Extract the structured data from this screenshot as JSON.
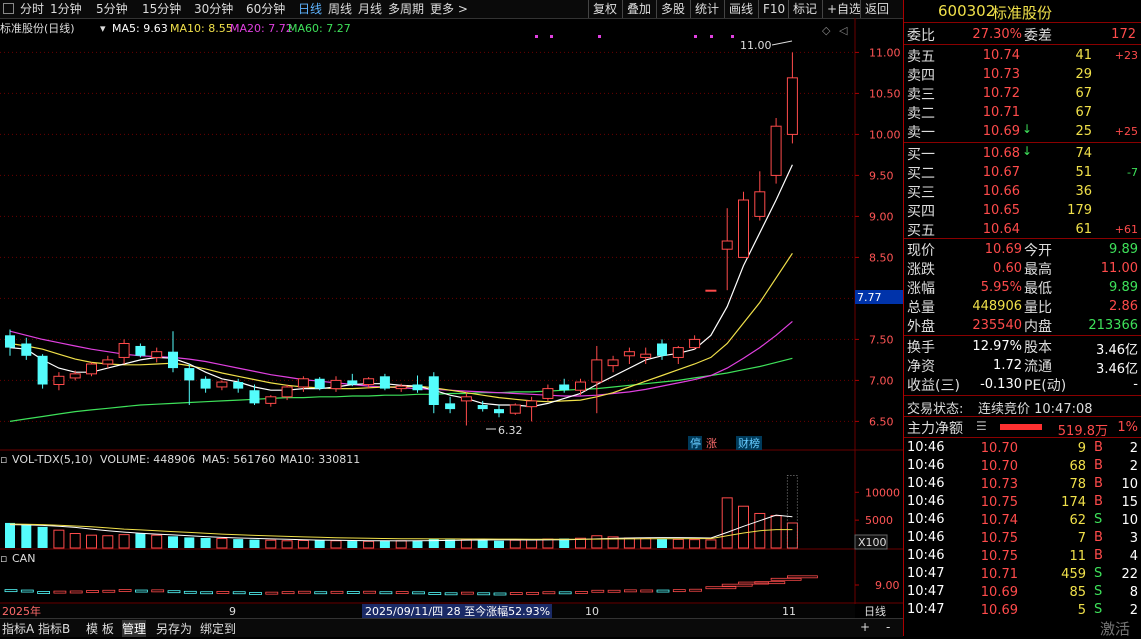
{
  "toolbar": {
    "periods": [
      "分时",
      "1分钟",
      "5分钟",
      "15分钟",
      "30分钟",
      "60分钟",
      "日线",
      "周线",
      "月线",
      "多周期",
      "更多 >"
    ],
    "active": "日线",
    "right": [
      "复权",
      "叠加",
      "多股",
      "统计",
      "画线",
      "F10",
      "标记",
      "+自选",
      "返回"
    ]
  },
  "main_legend": {
    "name": "标准股份(日线)",
    "ma5": "MA5: 9.63",
    "ma10": "MA10: 8.55",
    "ma20": "MA20: 7.72",
    "ma60": "MA60: 7.27"
  },
  "colors": {
    "up": "#ff4b4b",
    "down": "#54fcfc",
    "ma5": "#ffffff",
    "ma10": "#f0e04a",
    "ma20": "#e040e0",
    "ma60": "#3ee15a",
    "grid": "#6a0000"
  },
  "high_label": "11.00",
  "low_label": "6.32",
  "price_tag": "7.77",
  "tags": {
    "a": "停",
    "b": "涨",
    "c": "财榜"
  },
  "vol_legend": {
    "name": "VOL-TDX(5,10)",
    "volume": "VOLUME: 448906",
    "ma5": "MA5: 561760",
    "ma10": "MA10: 330811"
  },
  "vol_unit": "X100",
  "can_legend": "CAN",
  "date_axis": {
    "y2025": "2025年",
    "m9": "9",
    "m10": "10",
    "m11": "11",
    "range": "2025/09/11/四 28 至今涨幅52.93%",
    "period_btn": "日线"
  },
  "bottom_tabs": [
    "指标A",
    "指标B",
    "模 板",
    "管理",
    "另存为",
    "绑定到"
  ],
  "bottom_active": "管理",
  "bottom_controls": {
    "plus": "+",
    "minus": "-"
  },
  "chart_data": {
    "type": "candlestick",
    "price_axis": [
      11.0,
      10.5,
      10.0,
      9.5,
      9.0,
      8.5,
      8.0,
      7.5,
      7.0,
      6.5
    ],
    "ylim": [
      6.2,
      11.2
    ],
    "candles": [
      {
        "o": 7.55,
        "h": 7.62,
        "l": 7.3,
        "c": 7.4
      },
      {
        "o": 7.45,
        "h": 7.52,
        "l": 7.25,
        "c": 7.3
      },
      {
        "o": 7.3,
        "h": 7.32,
        "l": 6.9,
        "c": 6.95
      },
      {
        "o": 6.95,
        "h": 7.1,
        "l": 6.88,
        "c": 7.05
      },
      {
        "o": 7.03,
        "h": 7.12,
        "l": 7.0,
        "c": 7.08
      },
      {
        "o": 7.08,
        "h": 7.22,
        "l": 7.05,
        "c": 7.2
      },
      {
        "o": 7.2,
        "h": 7.3,
        "l": 7.15,
        "c": 7.25
      },
      {
        "o": 7.28,
        "h": 7.5,
        "l": 7.2,
        "c": 7.45
      },
      {
        "o": 7.42,
        "h": 7.45,
        "l": 7.28,
        "c": 7.3
      },
      {
        "o": 7.28,
        "h": 7.4,
        "l": 7.22,
        "c": 7.35
      },
      {
        "o": 7.35,
        "h": 7.6,
        "l": 7.1,
        "c": 7.15
      },
      {
        "o": 7.15,
        "h": 7.2,
        "l": 6.7,
        "c": 7.0
      },
      {
        "o": 7.02,
        "h": 7.05,
        "l": 6.85,
        "c": 6.9
      },
      {
        "o": 6.92,
        "h": 7.0,
        "l": 6.88,
        "c": 6.98
      },
      {
        "o": 6.98,
        "h": 7.02,
        "l": 6.85,
        "c": 6.9
      },
      {
        "o": 6.88,
        "h": 6.95,
        "l": 6.7,
        "c": 6.72
      },
      {
        "o": 6.72,
        "h": 6.82,
        "l": 6.68,
        "c": 6.8
      },
      {
        "o": 6.8,
        "h": 6.95,
        "l": 6.76,
        "c": 6.92
      },
      {
        "o": 6.92,
        "h": 7.05,
        "l": 6.86,
        "c": 7.02
      },
      {
        "o": 7.02,
        "h": 7.04,
        "l": 6.88,
        "c": 6.9
      },
      {
        "o": 6.9,
        "h": 7.05,
        "l": 6.86,
        "c": 7.0
      },
      {
        "o": 7.0,
        "h": 7.08,
        "l": 6.93,
        "c": 6.95
      },
      {
        "o": 6.95,
        "h": 7.04,
        "l": 6.9,
        "c": 7.02
      },
      {
        "o": 7.05,
        "h": 7.08,
        "l": 6.88,
        "c": 6.9
      },
      {
        "o": 6.9,
        "h": 6.96,
        "l": 6.86,
        "c": 6.93
      },
      {
        "o": 6.95,
        "h": 7.06,
        "l": 6.85,
        "c": 6.88
      },
      {
        "o": 7.05,
        "h": 7.1,
        "l": 6.6,
        "c": 6.7
      },
      {
        "o": 6.72,
        "h": 6.8,
        "l": 6.6,
        "c": 6.65
      },
      {
        "o": 6.75,
        "h": 6.85,
        "l": 6.45,
        "c": 6.8
      },
      {
        "o": 6.7,
        "h": 6.75,
        "l": 6.62,
        "c": 6.65
      },
      {
        "o": 6.65,
        "h": 6.7,
        "l": 6.55,
        "c": 6.6
      },
      {
        "o": 6.6,
        "h": 6.72,
        "l": 6.58,
        "c": 6.7
      },
      {
        "o": 6.68,
        "h": 6.8,
        "l": 6.5,
        "c": 6.75
      },
      {
        "o": 6.78,
        "h": 6.95,
        "l": 6.75,
        "c": 6.9
      },
      {
        "o": 6.95,
        "h": 7.02,
        "l": 6.85,
        "c": 6.88
      },
      {
        "o": 6.88,
        "h": 7.02,
        "l": 6.82,
        "c": 6.98
      },
      {
        "o": 6.98,
        "h": 7.42,
        "l": 6.6,
        "c": 7.25
      },
      {
        "o": 7.18,
        "h": 7.3,
        "l": 7.1,
        "c": 7.25
      },
      {
        "o": 7.3,
        "h": 7.4,
        "l": 7.2,
        "c": 7.35
      },
      {
        "o": 7.28,
        "h": 7.4,
        "l": 7.2,
        "c": 7.32
      },
      {
        "o": 7.45,
        "h": 7.5,
        "l": 7.25,
        "c": 7.3
      },
      {
        "o": 7.28,
        "h": 7.42,
        "l": 7.2,
        "c": 7.4
      },
      {
        "o": 7.4,
        "h": 7.55,
        "l": 7.38,
        "c": 7.5
      },
      {
        "o": 8.1,
        "h": 8.1,
        "l": 8.1,
        "c": 8.1
      },
      {
        "o": 8.6,
        "h": 9.1,
        "l": 8.1,
        "c": 8.7
      },
      {
        "o": 8.5,
        "h": 9.3,
        "l": 8.5,
        "c": 9.2
      },
      {
        "o": 9.0,
        "h": 9.55,
        "l": 8.95,
        "c": 9.3
      },
      {
        "o": 9.5,
        "h": 10.2,
        "l": 9.4,
        "c": 10.1
      },
      {
        "o": 10.0,
        "h": 11.0,
        "l": 9.89,
        "c": 10.69
      }
    ],
    "ma5": [
      7.4,
      7.38,
      7.25,
      7.15,
      7.1,
      7.1,
      7.15,
      7.2,
      7.25,
      7.28,
      7.27,
      7.2,
      7.1,
      7.02,
      6.98,
      6.92,
      6.88,
      6.88,
      6.9,
      6.9,
      6.92,
      6.95,
      6.96,
      6.96,
      6.94,
      6.93,
      6.88,
      6.82,
      6.78,
      6.72,
      6.7,
      6.7,
      6.68,
      6.72,
      6.78,
      6.84,
      6.95,
      7.05,
      7.15,
      7.25,
      7.3,
      7.33,
      7.38,
      7.55,
      7.9,
      8.4,
      8.8,
      9.2,
      9.63
    ],
    "ma10": [
      7.45,
      7.42,
      7.38,
      7.32,
      7.26,
      7.22,
      7.2,
      7.19,
      7.19,
      7.2,
      7.21,
      7.18,
      7.14,
      7.09,
      7.05,
      7.01,
      6.97,
      6.94,
      6.92,
      6.91,
      6.9,
      6.9,
      6.91,
      6.92,
      6.92,
      6.93,
      6.91,
      6.88,
      6.85,
      6.82,
      6.79,
      6.77,
      6.75,
      6.74,
      6.75,
      6.76,
      6.8,
      6.85,
      6.92,
      6.99,
      7.06,
      7.13,
      7.2,
      7.28,
      7.45,
      7.7,
      7.95,
      8.25,
      8.55
    ],
    "ma20": [
      7.6,
      7.55,
      7.5,
      7.46,
      7.42,
      7.38,
      7.35,
      7.32,
      7.3,
      7.29,
      7.28,
      7.26,
      7.23,
      7.19,
      7.15,
      7.11,
      7.07,
      7.04,
      7.01,
      6.99,
      6.97,
      6.95,
      6.93,
      6.92,
      6.91,
      6.9,
      6.89,
      6.88,
      6.87,
      6.86,
      6.85,
      6.84,
      6.83,
      6.82,
      6.81,
      6.81,
      6.82,
      6.84,
      6.86,
      6.89,
      6.93,
      6.97,
      7.01,
      7.06,
      7.15,
      7.27,
      7.4,
      7.55,
      7.72
    ],
    "ma60": [
      6.5,
      6.53,
      6.56,
      6.59,
      6.62,
      6.64,
      6.66,
      6.68,
      6.7,
      6.71,
      6.72,
      6.73,
      6.74,
      6.75,
      6.76,
      6.77,
      6.78,
      6.79,
      6.79,
      6.8,
      6.8,
      6.81,
      6.81,
      6.82,
      6.82,
      6.83,
      6.83,
      6.84,
      6.84,
      6.85,
      6.85,
      6.86,
      6.86,
      6.87,
      6.88,
      6.89,
      6.9,
      6.92,
      6.94,
      6.96,
      6.98,
      7.0,
      7.03,
      7.06,
      7.09,
      7.13,
      7.17,
      7.22,
      7.27
    ],
    "vol_axis": [
      10000,
      5000
    ],
    "vol_ylim": [
      0,
      14000
    ],
    "volume": [
      4500,
      4300,
      3800,
      3200,
      2600,
      2300,
      2200,
      2400,
      2600,
      2300,
      2100,
      1900,
      1800,
      1700,
      1600,
      1500,
      1400,
      1300,
      1350,
      1400,
      1300,
      1250,
      1200,
      1250,
      1300,
      1350,
      1600,
      1500,
      1450,
      1350,
      1300,
      1400,
      1500,
      1600,
      1700,
      1750,
      2200,
      2000,
      1800,
      1700,
      1600,
      1550,
      1500,
      1450,
      9000,
      7500,
      6200,
      5800,
      4489
    ],
    "vol_ma5": [
      4200,
      4150,
      4050,
      3900,
      3700,
      3400,
      3100,
      2850,
      2650,
      2500,
      2350,
      2200,
      2050,
      1900,
      1800,
      1720,
      1640,
      1560,
      1480,
      1420,
      1380,
      1340,
      1310,
      1290,
      1280,
      1290,
      1330,
      1370,
      1410,
      1440,
      1450,
      1450,
      1440,
      1450,
      1480,
      1540,
      1630,
      1730,
      1800,
      1850,
      1870,
      1860,
      1840,
      1800,
      2800,
      3900,
      4900,
      5900,
      5617
    ],
    "vol_ma10": [
      4300,
      4250,
      4200,
      4100,
      3950,
      3800,
      3600,
      3400,
      3250,
      3100,
      2950,
      2800,
      2650,
      2500,
      2380,
      2270,
      2170,
      2080,
      2000,
      1920,
      1850,
      1790,
      1740,
      1700,
      1670,
      1650,
      1640,
      1630,
      1620,
      1610,
      1600,
      1590,
      1580,
      1570,
      1570,
      1580,
      1600,
      1620,
      1640,
      1650,
      1660,
      1670,
      1680,
      1690,
      2200,
      2700,
      3100,
      3300,
      3308
    ],
    "can_axis": [
      9.0
    ]
  },
  "quote": {
    "code": "600302",
    "name": "标准股份",
    "weibi_label": "委比",
    "weibi": "27.30%",
    "weicha_label": "委差",
    "weicha": "172",
    "asks": [
      {
        "label": "卖五",
        "price": "10.74",
        "vol": "41",
        "chg": "+23",
        "arrow": ""
      },
      {
        "label": "卖四",
        "price": "10.73",
        "vol": "29",
        "chg": "",
        "arrow": ""
      },
      {
        "label": "卖三",
        "price": "10.72",
        "vol": "67",
        "chg": "",
        "arrow": ""
      },
      {
        "label": "卖二",
        "price": "10.71",
        "vol": "67",
        "chg": "",
        "arrow": ""
      },
      {
        "label": "卖一",
        "price": "10.69",
        "vol": "25",
        "chg": "+25",
        "arrow": "↓"
      }
    ],
    "bids": [
      {
        "label": "买一",
        "price": "10.68",
        "vol": "74",
        "chg": "",
        "arrow": "↓"
      },
      {
        "label": "买二",
        "price": "10.67",
        "vol": "51",
        "chg": "-7",
        "arrow": ""
      },
      {
        "label": "买三",
        "price": "10.66",
        "vol": "36",
        "chg": "",
        "arrow": ""
      },
      {
        "label": "买四",
        "price": "10.65",
        "vol": "179",
        "chg": "",
        "arrow": ""
      },
      {
        "label": "买五",
        "price": "10.64",
        "vol": "61",
        "chg": "+61",
        "arrow": ""
      }
    ],
    "stats": [
      {
        "l1": "现价",
        "v1": "10.69",
        "c1": "red",
        "l2": "今开",
        "v2": "9.89",
        "c2": "green"
      },
      {
        "l1": "涨跌",
        "v1": "0.60",
        "c1": "red",
        "l2": "最高",
        "v2": "11.00",
        "c2": "red"
      },
      {
        "l1": "涨幅",
        "v1": "5.95%",
        "c1": "red",
        "l2": "最低",
        "v2": "9.89",
        "c2": "green"
      },
      {
        "l1": "总量",
        "v1": "448906",
        "c1": "yellow",
        "l2": "量比",
        "v2": "2.86",
        "c2": "red"
      },
      {
        "l1": "外盘",
        "v1": "235540",
        "c1": "red",
        "l2": "内盘",
        "v2": "213366",
        "c2": "green"
      }
    ],
    "stats2": [
      {
        "l1": "换手",
        "v1": "12.97%",
        "l2": "股本",
        "v2": "3.46亿"
      },
      {
        "l1": "净资",
        "v1": "1.72",
        "l2": "流通",
        "v2": "3.46亿"
      },
      {
        "l1": "收益(三)",
        "v1": "-0.130",
        "l2": "PE(动)",
        "v2": "-"
      }
    ],
    "status_label": "交易状态:",
    "status": "连续竞价 10:47:08",
    "main_flow_label": "主力净额",
    "main_flow": "519.8万",
    "main_flow_pct": "1%",
    "ticks": [
      {
        "t": "10:46",
        "p": "10.70",
        "v": "9",
        "s": "B",
        "n": "2"
      },
      {
        "t": "10:46",
        "p": "10.70",
        "v": "68",
        "s": "B",
        "n": "2"
      },
      {
        "t": "10:46",
        "p": "10.73",
        "v": "78",
        "s": "B",
        "n": "10"
      },
      {
        "t": "10:46",
        "p": "10.75",
        "v": "174",
        "s": "B",
        "n": "15"
      },
      {
        "t": "10:46",
        "p": "10.74",
        "v": "62",
        "s": "S",
        "n": "10"
      },
      {
        "t": "10:46",
        "p": "10.75",
        "v": "7",
        "s": "B",
        "n": "3"
      },
      {
        "t": "10:46",
        "p": "10.75",
        "v": "11",
        "s": "B",
        "n": "4"
      },
      {
        "t": "10:47",
        "p": "10.71",
        "v": "459",
        "s": "S",
        "n": "22"
      },
      {
        "t": "10:47",
        "p": "10.69",
        "v": "85",
        "s": "S",
        "n": "8"
      },
      {
        "t": "10:47",
        "p": "10.69",
        "v": "5",
        "s": "S",
        "n": "2"
      }
    ],
    "watermark": "激活"
  }
}
